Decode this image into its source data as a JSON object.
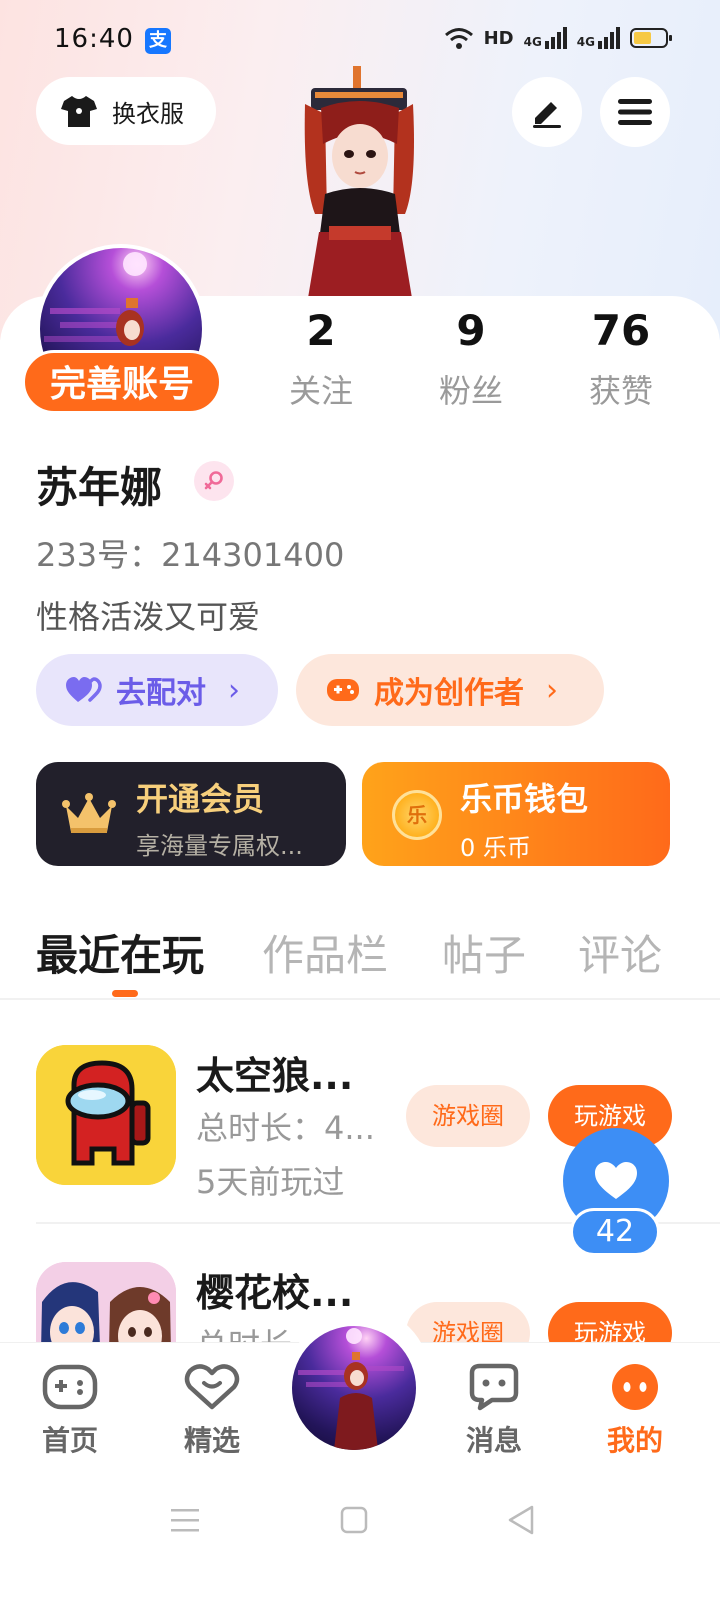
{
  "status_bar": {
    "time": "16:40",
    "network_hd": "HD",
    "network_4g_1": "4G",
    "network_4g_2": "4G",
    "battery_level": 0.55
  },
  "header": {
    "outfit_button_label": "换衣服"
  },
  "profile": {
    "complete_account_label": "完善账号",
    "stats": [
      {
        "value": "2",
        "label": "关注"
      },
      {
        "value": "9",
        "label": "粉丝"
      },
      {
        "value": "76",
        "label": "获赞"
      }
    ],
    "username": "苏年娜",
    "id_text": "233号：214301400",
    "bio": "性格活泼又可爱",
    "match_button": "去配对",
    "creator_button": "成为创作者"
  },
  "vip": {
    "title": "开通会员",
    "subtitle": "享海量专属权..."
  },
  "wallet": {
    "title": "乐币钱包",
    "balance": "0 乐币",
    "coin_glyph": "乐"
  },
  "tabs": [
    {
      "label": "最近在玩",
      "active": true
    },
    {
      "label": "作品栏",
      "active": false
    },
    {
      "label": "帖子",
      "active": false
    },
    {
      "label": "评论",
      "active": false
    }
  ],
  "games": [
    {
      "title": "太空狼...",
      "duration": "总时长：4...",
      "last_played": "5天前玩过",
      "circle_button": "游戏圈",
      "play_button": "玩游戏"
    },
    {
      "title": "樱花校...",
      "duration": "总时长...",
      "circle_button": "游戏圈",
      "play_button": "玩游戏"
    }
  ],
  "like_fab": {
    "count": "42"
  },
  "bottom_nav": [
    {
      "label": "首页",
      "icon": "gamepad-icon",
      "active": false
    },
    {
      "label": "精选",
      "icon": "heart-chat-icon",
      "active": false
    },
    {
      "label": "消息",
      "icon": "message-icon",
      "active": false
    },
    {
      "label": "我的",
      "icon": "me-icon",
      "active": true
    }
  ],
  "colors": {
    "accent": "#ff6a1a",
    "match_purple": "#6b5ce8",
    "like_blue": "#3d8ef5",
    "vip_gold": "#f7cf7c"
  }
}
